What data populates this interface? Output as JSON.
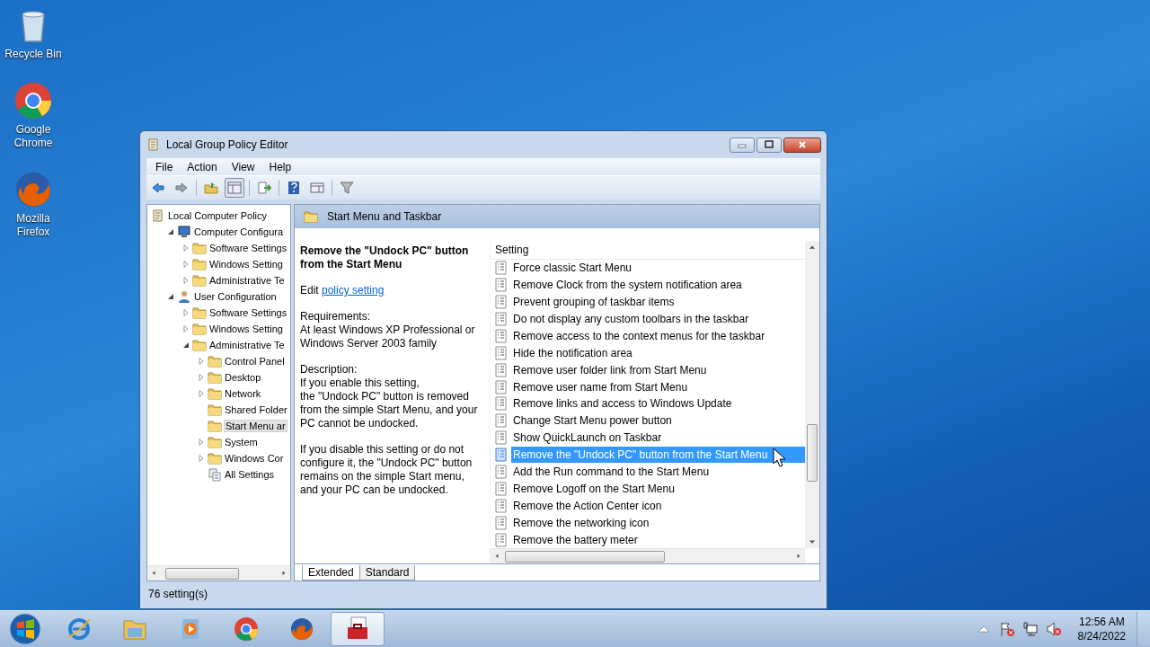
{
  "desktop_icons": [
    {
      "label": "Recycle Bin",
      "kind": "bin"
    },
    {
      "label": "Google Chrome",
      "kind": "chrome"
    },
    {
      "label": "Mozilla Firefox",
      "kind": "firefox"
    }
  ],
  "window": {
    "title": "Local Group Policy Editor",
    "menu": [
      "File",
      "Action",
      "View",
      "Help"
    ],
    "tree": [
      {
        "label": "Local Computer Policy",
        "kind": "policy",
        "selected": false,
        "children": [
          {
            "label": "Computer Configura",
            "kind": "computer",
            "expanded": true,
            "selected": false,
            "children": [
              {
                "label": "Software Settings",
                "kind": "folder",
                "expanded": false,
                "selected": false
              },
              {
                "label": "Windows Setting",
                "kind": "folder",
                "expanded": false,
                "selected": false
              },
              {
                "label": "Administrative Te",
                "kind": "folder",
                "expanded": false,
                "selected": false
              }
            ]
          },
          {
            "label": "User Configuration",
            "kind": "user",
            "expanded": true,
            "selected": false,
            "children": [
              {
                "label": "Software Settings",
                "kind": "folder",
                "expanded": false,
                "selected": false
              },
              {
                "label": "Windows Setting",
                "kind": "folder",
                "expanded": false,
                "selected": false
              },
              {
                "label": "Administrative Te",
                "kind": "folder",
                "expanded": true,
                "selected": false,
                "children": [
                  {
                    "label": "Control Panel",
                    "kind": "folder",
                    "expanded": false,
                    "selected": false
                  },
                  {
                    "label": "Desktop",
                    "kind": "folder",
                    "expanded": false,
                    "selected": false
                  },
                  {
                    "label": "Network",
                    "kind": "folder",
                    "expanded": false,
                    "selected": false
                  },
                  {
                    "label": "Shared Folder",
                    "kind": "folder",
                    "selected": false
                  },
                  {
                    "label": "Start Menu ar",
                    "kind": "folder",
                    "selected": true
                  },
                  {
                    "label": "System",
                    "kind": "folder",
                    "expanded": false,
                    "selected": false
                  },
                  {
                    "label": "Windows Cor",
                    "kind": "folder",
                    "expanded": false,
                    "selected": false
                  },
                  {
                    "label": "All Settings",
                    "kind": "settings",
                    "selected": false
                  }
                ]
              }
            ]
          }
        ]
      }
    ],
    "header": "Start Menu and Taskbar",
    "description": {
      "title": "Remove the \"Undock PC\" button\nfrom the Start Menu",
      "edit_prefix": "Edit",
      "edit_link": "policy setting",
      "requirements": "Requirements:\nAt least Windows XP Professional or\nWindows Server 2003 family",
      "description": "Description:\nIf you enable this setting,\nthe \"Undock PC\" button is removed\nfrom the simple Start Menu, and your\nPC cannot be undocked.",
      "note": "If you disable this setting or do not\nconfigure it, the \"Undock PC\" button\nremains on the simple Start menu,\nand your PC can be undocked."
    },
    "column": "Setting",
    "settings": [
      {
        "label": "Force classic Start Menu",
        "selected": false
      },
      {
        "label": "Remove Clock from the system notification area",
        "selected": false
      },
      {
        "label": "Prevent grouping of taskbar items",
        "selected": false
      },
      {
        "label": "Do not display any custom toolbars in the taskbar",
        "selected": false
      },
      {
        "label": "Remove access to the context menus for the taskbar",
        "selected": false
      },
      {
        "label": "Hide the notification area",
        "selected": false
      },
      {
        "label": "Remove user folder link from Start Menu",
        "selected": false
      },
      {
        "label": "Remove user name from Start Menu",
        "selected": false
      },
      {
        "label": "Remove links and access to Windows Update",
        "selected": false
      },
      {
        "label": "Change Start Menu power button",
        "selected": false
      },
      {
        "label": "Show QuickLaunch on Taskbar",
        "selected": false
      },
      {
        "label": "Remove the \"Undock PC\" button from the Start Menu",
        "selected": true
      },
      {
        "label": "Add the Run command to the Start Menu",
        "selected": false
      },
      {
        "label": "Remove Logoff on the Start Menu",
        "selected": false
      },
      {
        "label": "Remove the Action Center icon",
        "selected": false
      },
      {
        "label": "Remove the networking icon",
        "selected": false
      },
      {
        "label": "Remove the battery meter",
        "selected": false
      }
    ],
    "tabs": [
      {
        "label": "Extended",
        "selected": true
      },
      {
        "label": "Standard",
        "selected": false
      }
    ],
    "status": "76 setting(s)"
  },
  "taskbar": {
    "apps": [
      {
        "kind": "ie",
        "selected": false
      },
      {
        "kind": "explorer",
        "selected": false
      },
      {
        "kind": "media",
        "selected": false
      },
      {
        "kind": "chrome",
        "selected": false
      },
      {
        "kind": "firefox",
        "selected": false
      },
      {
        "kind": "toolbox",
        "selected": true
      }
    ],
    "time": "12:56 AM",
    "date": "8/24/2022"
  }
}
